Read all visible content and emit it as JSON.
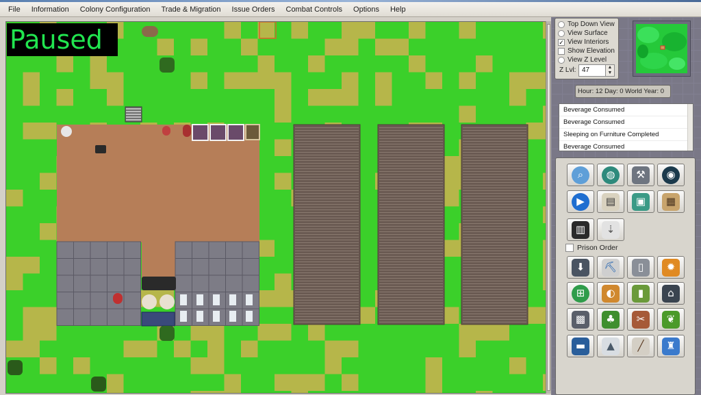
{
  "menu": [
    "File",
    "Information",
    "Colony Configuration",
    "Trade & Migration",
    "Issue Orders",
    "Combat Controls",
    "Options",
    "Help"
  ],
  "status": {
    "paused_text": "Paused"
  },
  "view_options": [
    {
      "label": "Top Down View",
      "kind": "radio",
      "checked": true
    },
    {
      "label": "View Surface",
      "kind": "radio",
      "checked": false
    },
    {
      "label": "View Interiors",
      "kind": "check",
      "checked": true
    },
    {
      "label": "Show Elevation",
      "kind": "check",
      "checked": false
    },
    {
      "label": "View Z Level",
      "kind": "radio",
      "checked": false
    }
  ],
  "z_level": {
    "label": "Z Lvl:",
    "value": "47"
  },
  "time": {
    "text": "Hour: 12 Day: 0 World Year: 0"
  },
  "messages": [
    "Beverage Consumed",
    "Beverage Consumed",
    "Sleeping on Furniture Completed",
    "Beverage Consumed"
  ],
  "prison_order": {
    "label": "Prison Order",
    "checked": false
  },
  "tool_rows_top": [
    [
      "magnifier-icon",
      "globe-icon",
      "workshop-icon",
      "eye-icon"
    ],
    [
      "play-icon",
      "book-icon",
      "machine-icon",
      "scroll-icon"
    ],
    [
      "stockpile-icon",
      "shovel-icon"
    ]
  ],
  "tool_rows_bottom": [
    [
      "drill-icon",
      "pickaxe-icon",
      "armor-icon",
      "fire-icon"
    ],
    [
      "grid-icon",
      "beacon-icon",
      "battery-icon",
      "factory-icon"
    ],
    [
      "crate-icon",
      "sprout-icon",
      "harvest-icon",
      "leaf-icon"
    ],
    [
      "vehicle-icon",
      "crystal-icon",
      "rifle-icon",
      "tower-icon"
    ]
  ],
  "colors": {
    "grass": "#3bd02a",
    "dry_grass": "#b6b64a",
    "dirt": "#b67e58",
    "crop": "#6a5a52",
    "floor": "#7d7c86",
    "paused_text": "#21e54f"
  }
}
